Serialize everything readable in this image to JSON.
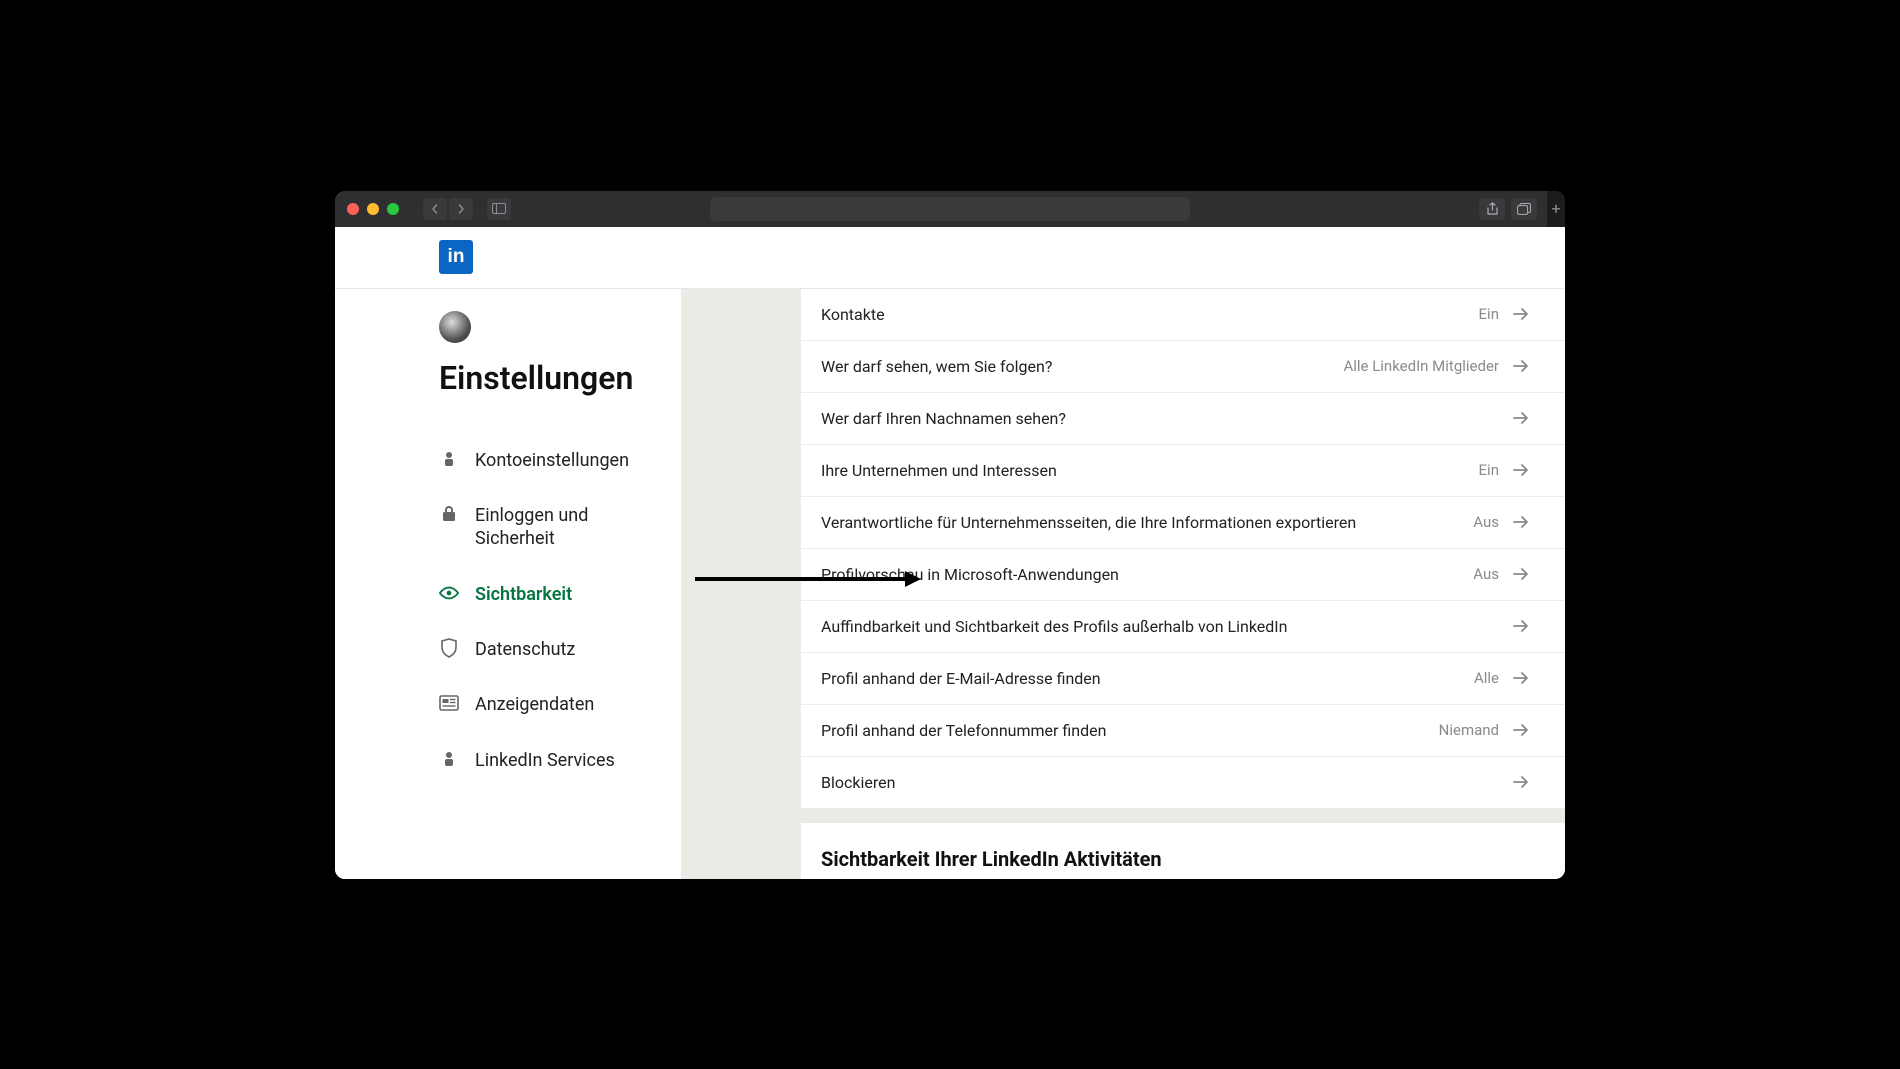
{
  "page_title": "Einstellungen",
  "logo_text": "in",
  "sidebar": {
    "items": [
      {
        "id": "account",
        "label": "Kontoeinstellungen"
      },
      {
        "id": "signin",
        "label": "Einloggen und Sicherheit"
      },
      {
        "id": "visibility",
        "label": "Sichtbarkeit",
        "active": true
      },
      {
        "id": "privacy",
        "label": "Datenschutz"
      },
      {
        "id": "ads",
        "label": "Anzeigendaten"
      },
      {
        "id": "services",
        "label": "LinkedIn Services"
      }
    ]
  },
  "rows": [
    {
      "label": "Kontakte",
      "value": "Ein"
    },
    {
      "label": "Wer darf sehen, wem Sie folgen?",
      "value": "Alle LinkedIn Mitglieder"
    },
    {
      "label": "Wer darf Ihren Nachnamen sehen?",
      "value": ""
    },
    {
      "label": "Ihre Unternehmen und Interessen",
      "value": "Ein"
    },
    {
      "label": "Verantwortliche für Unternehmensseiten, die Ihre Informationen exportieren",
      "value": "Aus"
    },
    {
      "label": "Profilvorschau in Microsoft-Anwendungen",
      "value": "Aus"
    },
    {
      "label": "Auffindbarkeit und Sichtbarkeit des Profils außerhalb von LinkedIn",
      "value": ""
    },
    {
      "label": "Profil anhand der E-Mail-Adresse finden",
      "value": "Alle"
    },
    {
      "label": "Profil anhand der Telefonnummer finden",
      "value": "Niemand"
    },
    {
      "label": "Blockieren",
      "value": ""
    }
  ],
  "section_heading": "Sichtbarkeit Ihrer LinkedIn Aktivitäten"
}
